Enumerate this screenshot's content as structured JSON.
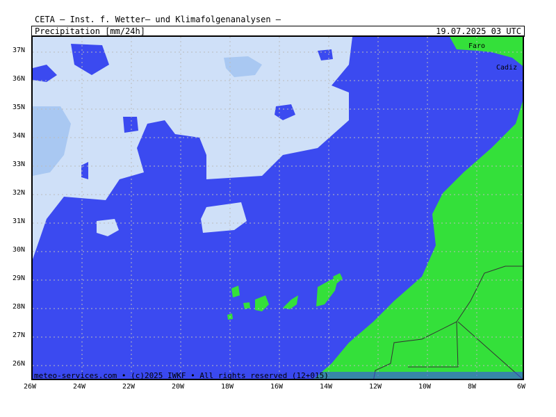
{
  "header": {
    "title": "CETA — Inst. f. Wetter— und Klimafolgenanalysen —",
    "subtitle": "Precipitation [mm/24h]",
    "datetime": "19.07.2025 03 UTC"
  },
  "footer": {
    "copyright": "meteo-services.com • (c)2025 IWKF • All rights reserved (12+015)"
  },
  "map": {
    "lon_range": [
      -26,
      -6
    ],
    "lat_range": [
      25.6,
      37.8
    ],
    "lon_ticks": [
      "26W",
      "24W",
      "22W",
      "20W",
      "18W",
      "16W",
      "14W",
      "12W",
      "10W",
      "8W",
      "6W"
    ],
    "lat_ticks": [
      "37N",
      "36N",
      "35N",
      "34N",
      "33N",
      "32N",
      "31N",
      "30N",
      "29N",
      "28N",
      "27N",
      "26N"
    ],
    "cities": [
      {
        "name": "Faro"
      },
      {
        "name": "Cadiz"
      }
    ],
    "colors": {
      "ocean": "#3b4af0",
      "land": "#34e03a",
      "precip_light": "#cfe0f8",
      "precip_mid": "#a9c8f2",
      "precip_heavy": "#7aa9ee",
      "grid": "#bbbbbb"
    }
  }
}
